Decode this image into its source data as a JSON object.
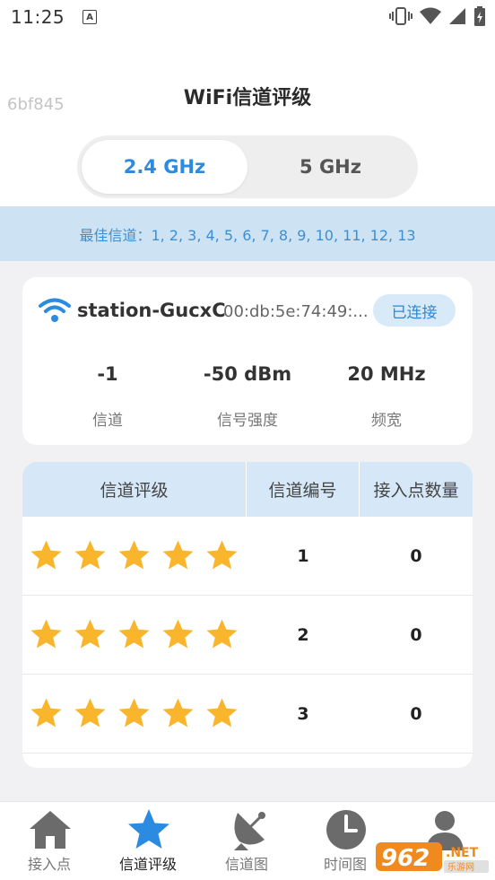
{
  "status_bar": {
    "time": "11:25",
    "notification_icon": "a-icon",
    "right_icons": [
      "vibrate-icon",
      "wifi-icon",
      "signal-icon",
      "battery-icon"
    ]
  },
  "header": {
    "watermark": "6bf845",
    "title": "WiFi信道评级",
    "bands": [
      {
        "label": "2.4 GHz",
        "selected": true
      },
      {
        "label": "5 GHz",
        "selected": false
      }
    ]
  },
  "best_channels": "最佳信道：1, 2, 3, 4, 5, 6, 7, 8, 9, 10, 11, 12, 13",
  "connection": {
    "ssid": "station-GucxC",
    "mac": "00:db:5e:74:49:...",
    "badge": "已连接",
    "stats": [
      {
        "value": "-1",
        "label": "信道"
      },
      {
        "value": "-50 dBm",
        "label": "信号强度"
      },
      {
        "value": "20 MHz",
        "label": "频宽"
      }
    ]
  },
  "table": {
    "headers": [
      "信道评级",
      "信道编号",
      "接入点数量"
    ],
    "rows": [
      {
        "stars": 5,
        "channel": "1",
        "ap_count": "0"
      },
      {
        "stars": 5,
        "channel": "2",
        "ap_count": "0"
      },
      {
        "stars": 5,
        "channel": "3",
        "ap_count": "0"
      }
    ]
  },
  "bottom_nav": [
    {
      "label": "接入点",
      "icon": "home-icon",
      "active": false
    },
    {
      "label": "信道评级",
      "icon": "star-icon",
      "active": true
    },
    {
      "label": "信道图",
      "icon": "satellite-dish-icon",
      "active": false
    },
    {
      "label": "时间图",
      "icon": "clock-icon",
      "active": false
    },
    {
      "label": "",
      "icon": "person-icon",
      "active": false
    }
  ],
  "colors": {
    "accent": "#2a8be0",
    "star": "#f9b52b",
    "best_bar_bg": "#cde3f4",
    "table_header_bg": "#d6e8f7"
  }
}
